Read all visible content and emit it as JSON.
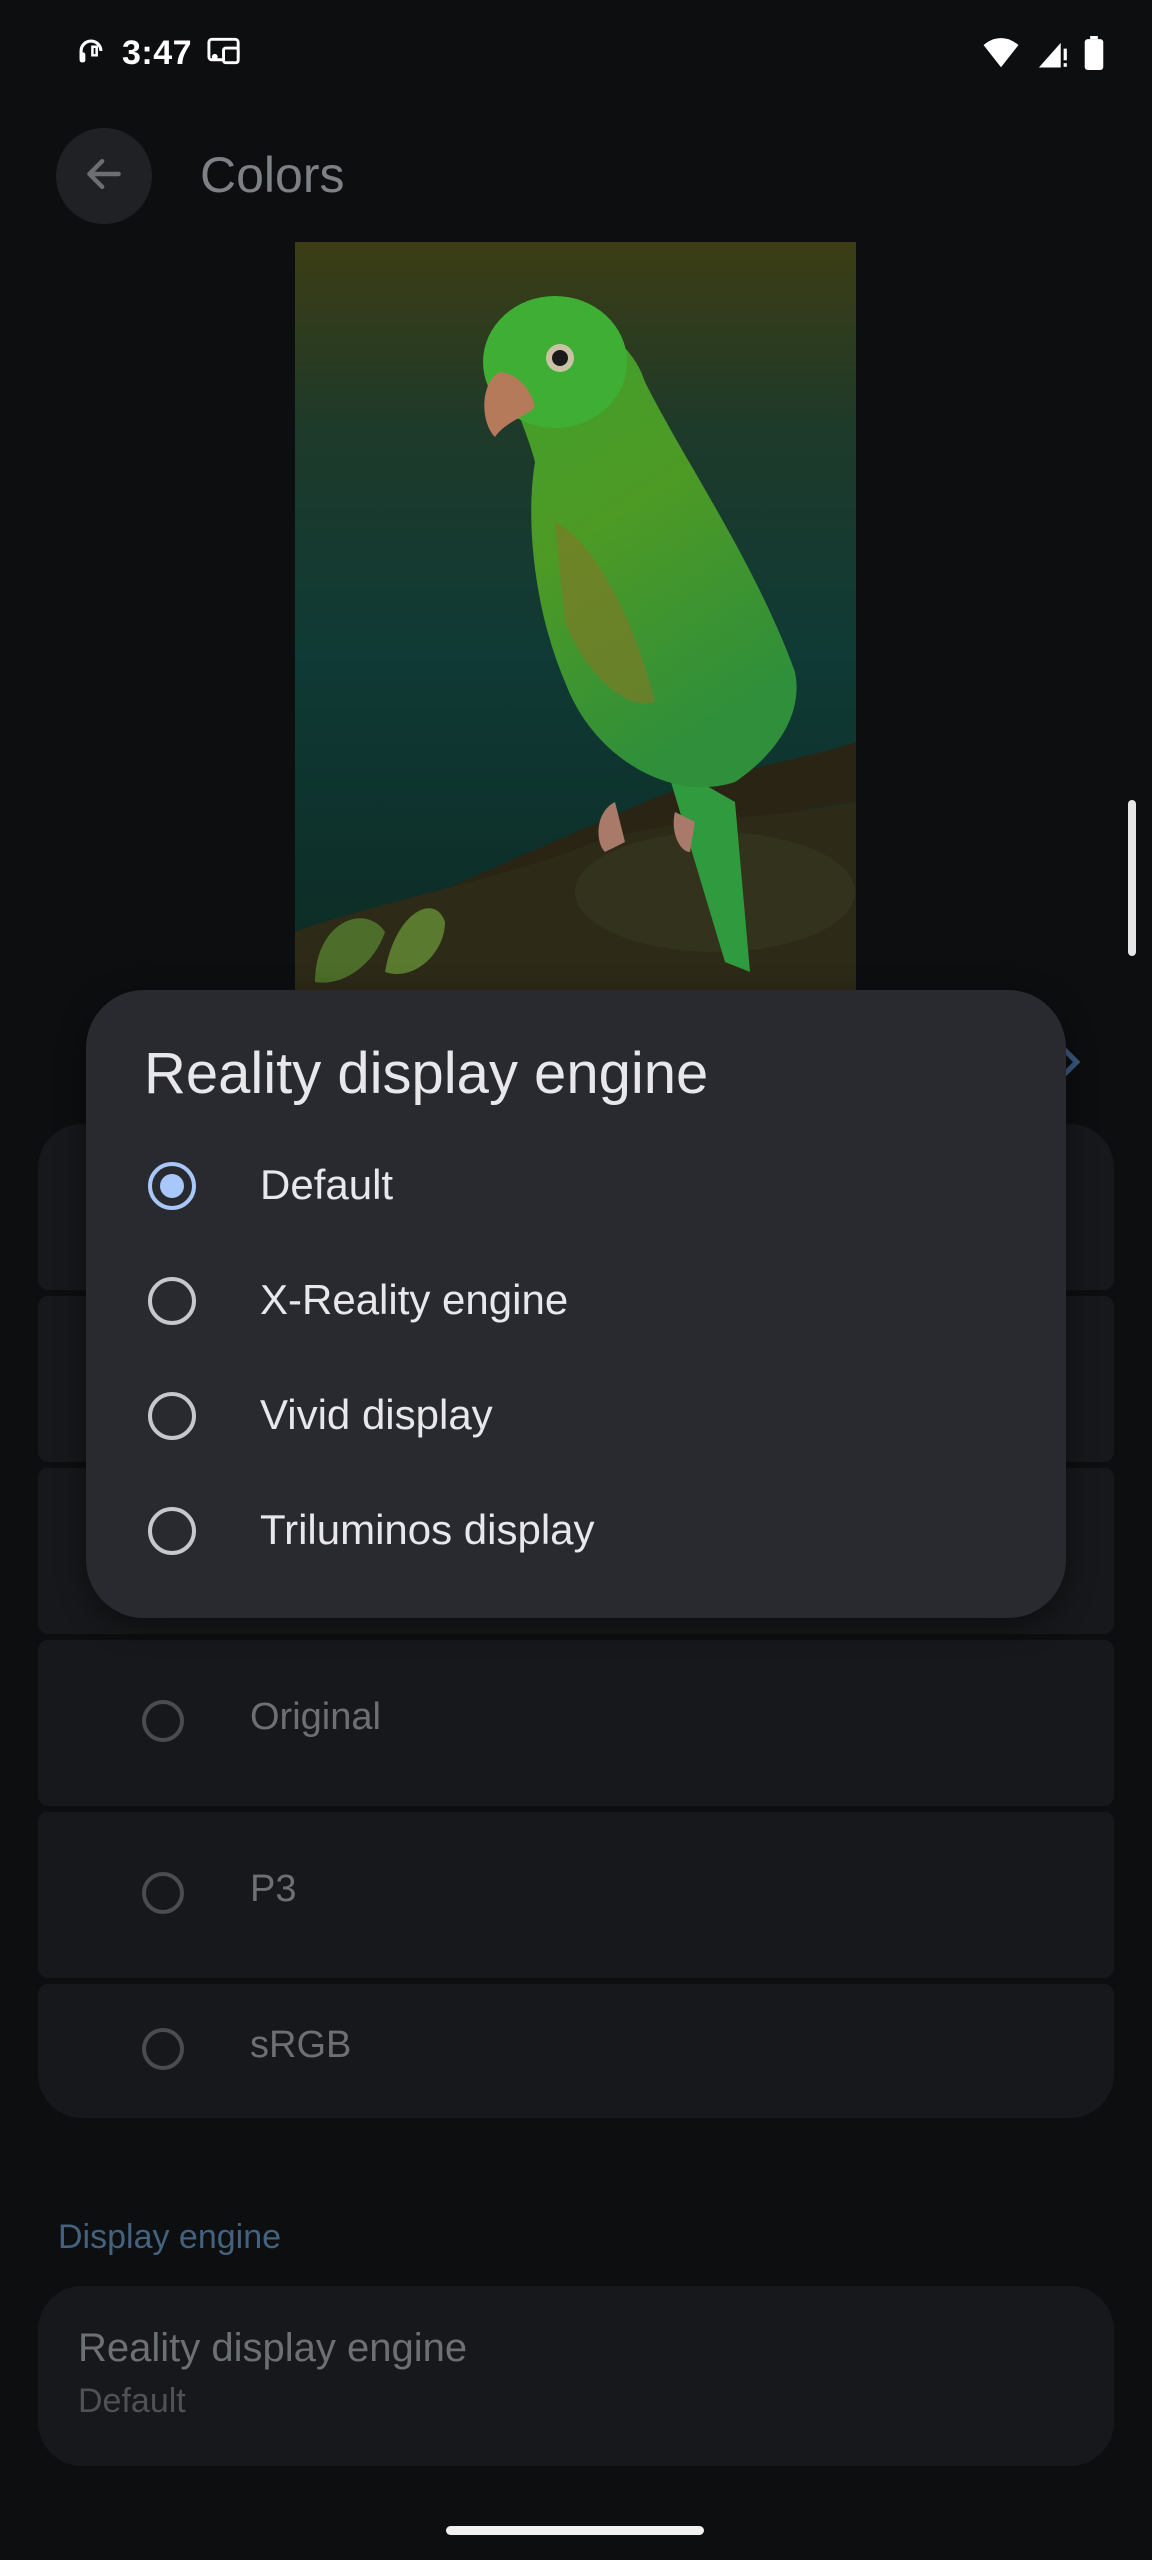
{
  "status_bar": {
    "time": "3:47"
  },
  "app_bar": {
    "title": "Colors"
  },
  "color_options": [
    {
      "label": "Original"
    },
    {
      "label": "P3"
    },
    {
      "label": "sRGB"
    }
  ],
  "display_engine_section": {
    "header": "Display engine",
    "item_title": "Reality display engine",
    "item_value": "Default"
  },
  "dialog": {
    "title": "Reality display engine",
    "options": [
      {
        "label": "Default",
        "selected": true
      },
      {
        "label": "X-Reality engine",
        "selected": false
      },
      {
        "label": "Vivid display",
        "selected": false
      },
      {
        "label": "Triluminos display",
        "selected": false
      }
    ]
  },
  "colors": {
    "accent": "#a8c7fa",
    "dialog_bg": "#292a30",
    "background": "#0d0e10"
  },
  "icons": {
    "status_left": [
      "headphones-icon",
      "cast-icon"
    ],
    "status_right": [
      "wifi-icon",
      "signal-icon",
      "battery-icon"
    ],
    "back": "back-arrow-icon",
    "side": "chevron-right-icon"
  }
}
